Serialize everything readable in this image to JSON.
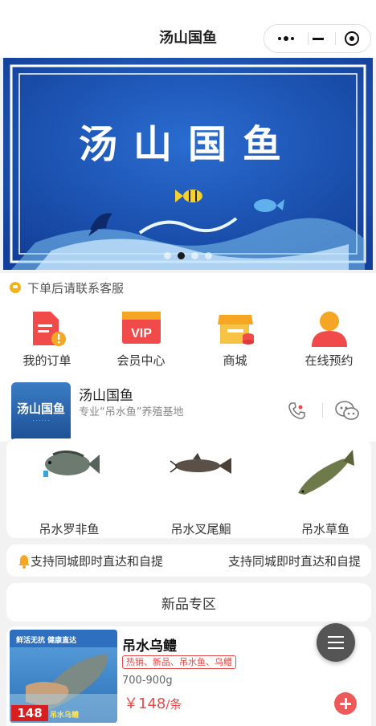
{
  "navbar": {
    "title": "汤山国鱼"
  },
  "banner": {
    "title": "汤山国鱼",
    "slides": 4,
    "active_slide": 2
  },
  "notice": {
    "text": "下单后请联系客服"
  },
  "quick_menu": [
    {
      "label": "我的订单",
      "icon": "order-icon"
    },
    {
      "label": "会员中心",
      "icon": "vip-icon"
    },
    {
      "label": "商城",
      "icon": "shop-icon"
    },
    {
      "label": "在线预约",
      "icon": "user-icon"
    }
  ],
  "store": {
    "logo_text": "汤山国鱼",
    "name": "汤山国鱼",
    "desc": "专业“吊水鱼”养殖基地"
  },
  "fish_list": [
    {
      "label": "吊水罗非鱼"
    },
    {
      "label": "吊水叉尾鮰"
    },
    {
      "label": "吊水草鱼"
    }
  ],
  "marquee": {
    "text": "支持同城即时直达和自提"
  },
  "section": {
    "title": "新品专区"
  },
  "product": {
    "image_top_text": "鲜活无抗 健康直达",
    "image_price": "148",
    "image_tag": "吊水乌鳢",
    "name": "吊水乌鳢",
    "tags": "热销、新品、吊水鱼、乌鳢",
    "spec": "700-900g",
    "price": "￥148",
    "unit": "/条"
  },
  "colors": {
    "accent": "#e84a4a",
    "banner": "#1e55b6"
  }
}
